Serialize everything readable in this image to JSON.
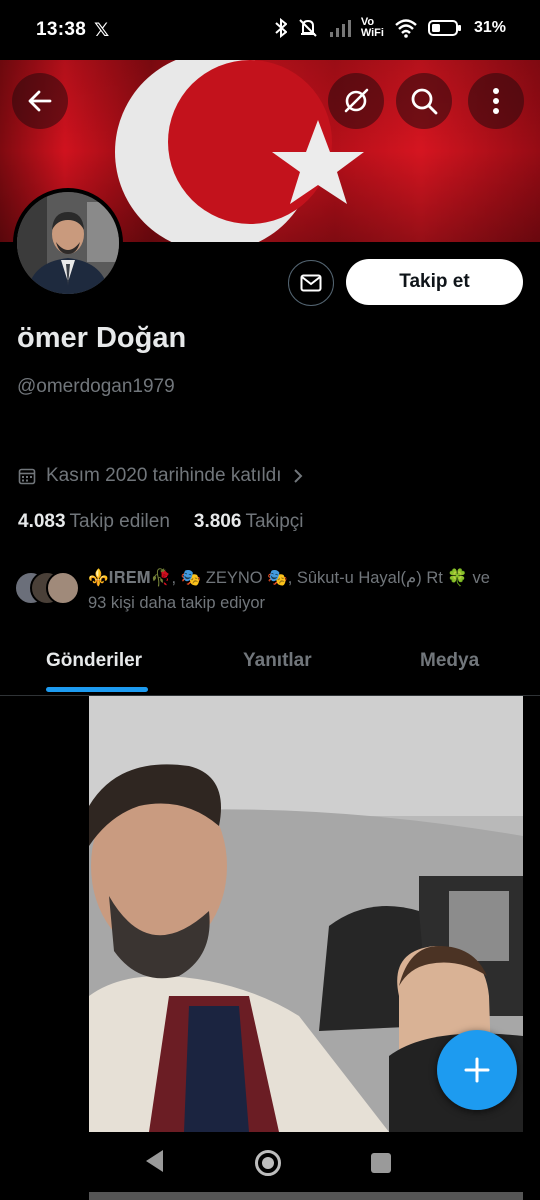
{
  "status_bar": {
    "time": "13:38",
    "x_logo": "𝕏",
    "icons": [
      "bluetooth-icon",
      "mute-icon",
      "signal-icon",
      "vowifi-icon",
      "wifi-icon",
      "battery-icon"
    ],
    "vowifi_top": "Vo",
    "vowifi_bottom": "WiFi",
    "battery": "31%"
  },
  "header": {
    "back_icon": "arrow-left-icon",
    "grok_icon": "grok-icon",
    "search_icon": "search-icon",
    "more_icon": "more-vertical-icon",
    "banner_colors": {
      "red": "#c8101c",
      "white": "#ffffff"
    }
  },
  "profile": {
    "display_name": "ömer Doğan",
    "handle": "@omerdogan1979",
    "joined": "Kasım 2020 tarihinde katıldı",
    "following_count": "4.083",
    "following_label": "Takip edilen",
    "followers_count": "3.806",
    "followers_label": "Takipçi",
    "followed_by_line1": "⚜️𝐈𝐑𝐄𝐌🥀, 🎭 ZEYNO 🎭, Sûkut-u Hayal(م) Rt 🍀 ve",
    "followed_by_line2": "93 kişi daha takip ediyor"
  },
  "actions": {
    "message_icon": "envelope-icon",
    "follow_label": "Takip et"
  },
  "tabs": [
    {
      "label": "Gönderiler",
      "active": true
    },
    {
      "label": "Yanıtlar",
      "active": false
    },
    {
      "label": "Medya",
      "active": false
    }
  ],
  "fab": {
    "icon": "plus-icon"
  },
  "nav": {
    "icons": [
      "nav-back-icon",
      "nav-home-icon",
      "nav-recents-icon"
    ]
  },
  "colors": {
    "accent": "#1d9bf0",
    "muted": "#71767b",
    "text": "#e7e9ea",
    "background": "#000000"
  }
}
